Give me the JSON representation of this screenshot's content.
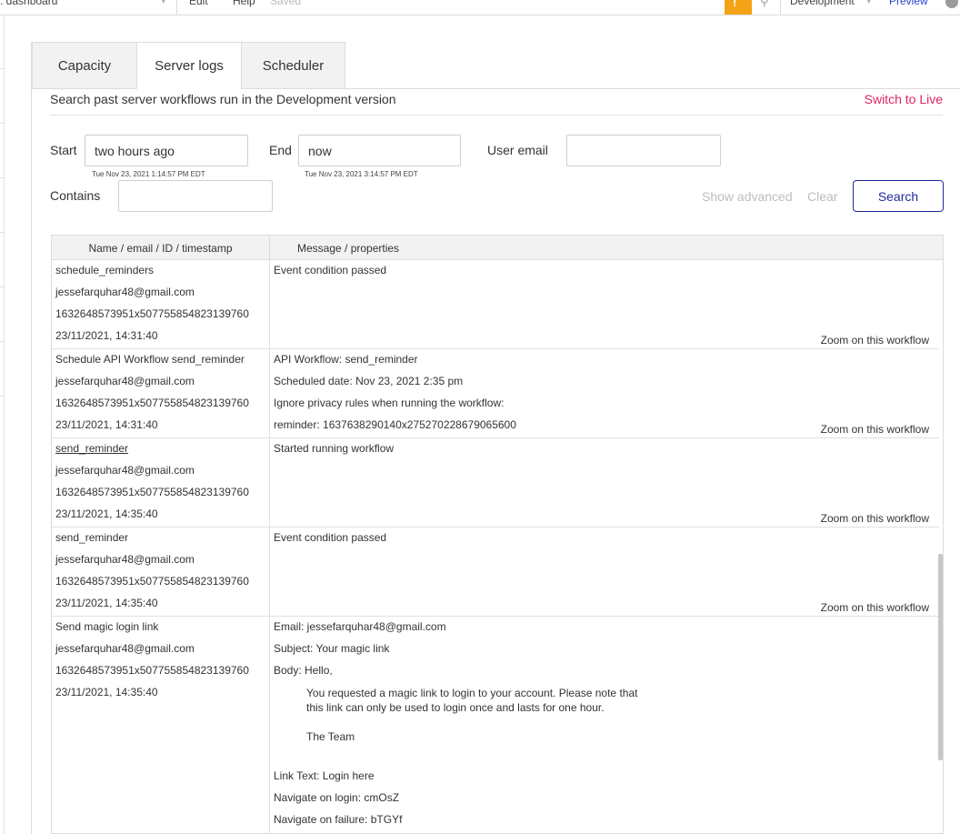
{
  "topbar": {
    "app_name": ": dashboard",
    "menu_edit": "Edit",
    "menu_help": "Help",
    "saved": "Saved",
    "environment": "Development",
    "preview": "Preview",
    "accent_color": "#f5a316"
  },
  "tabs": [
    {
      "label": "Capacity",
      "active": false
    },
    {
      "label": "Server logs",
      "active": true
    },
    {
      "label": "Scheduler",
      "active": false
    }
  ],
  "header": {
    "subtitle": "Search past server workflows run in the Development version",
    "switch_live": "Switch to Live"
  },
  "filters": {
    "start_label": "Start",
    "start_value": "two hours ago",
    "start_hint": "Tue Nov 23, 2021 1:14:57 PM EDT",
    "end_label": "End",
    "end_value": "now",
    "end_hint": "Tue Nov 23, 2021 3:14:57 PM EDT",
    "email_label": "User email",
    "email_value": "",
    "contains_label": "Contains",
    "contains_value": "",
    "show_advanced": "Show advanced",
    "clear": "Clear",
    "search": "Search"
  },
  "table": {
    "col1_header": "Name / email / ID / timestamp",
    "col2_header": "Message / properties",
    "zoom_label": "Zoom on this workflow",
    "rows": [
      {
        "name": "schedule_reminders",
        "email": "jessefarquhar48@gmail.com",
        "id": "1632648573951x507755854823139760",
        "timestamp": "23/11/2021, 14:31:40",
        "messages": [
          "Event condition passed"
        ]
      },
      {
        "name": "Schedule API Workflow send_reminder",
        "email": "jessefarquhar48@gmail.com",
        "id": "1632648573951x507755854823139760",
        "timestamp": "23/11/2021, 14:31:40",
        "messages": [
          "API Workflow:  send_reminder",
          "Scheduled date:  Nov 23, 2021 2:35 pm",
          "Ignore privacy rules when running the workflow:",
          "reminder:  1637638290140x275270228679065600"
        ]
      },
      {
        "name": "send_reminder",
        "email": "jessefarquhar48@gmail.com",
        "id": "1632648573951x507755854823139760",
        "timestamp": "23/11/2021, 14:35:40",
        "messages": [
          "Started running workflow"
        ]
      },
      {
        "name": "send_reminder",
        "email": "jessefarquhar48@gmail.com",
        "id": "1632648573951x507755854823139760",
        "timestamp": "23/11/2021, 14:35:40",
        "messages": [
          "Event condition passed"
        ]
      },
      {
        "name": "Send magic login link",
        "email": "jessefarquhar48@gmail.com",
        "id": "1632648573951x507755854823139760",
        "timestamp": "23/11/2021, 14:35:40",
        "email_fields": {
          "email": "Email:  jessefarquhar48@gmail.com",
          "subject": "Subject:  Your magic link",
          "body_label": "Body:  Hello,",
          "body_line1": "You requested a magic link to login to your account. Please note that",
          "body_line2": "this link can only be used to login once and lasts for one hour.",
          "body_sign": "The Team",
          "link_text": "Link Text:  Login here",
          "navigate_login": "Navigate on login:  cmOsZ",
          "navigate_failure": "Navigate on failure:  bTGYf"
        }
      }
    ]
  }
}
